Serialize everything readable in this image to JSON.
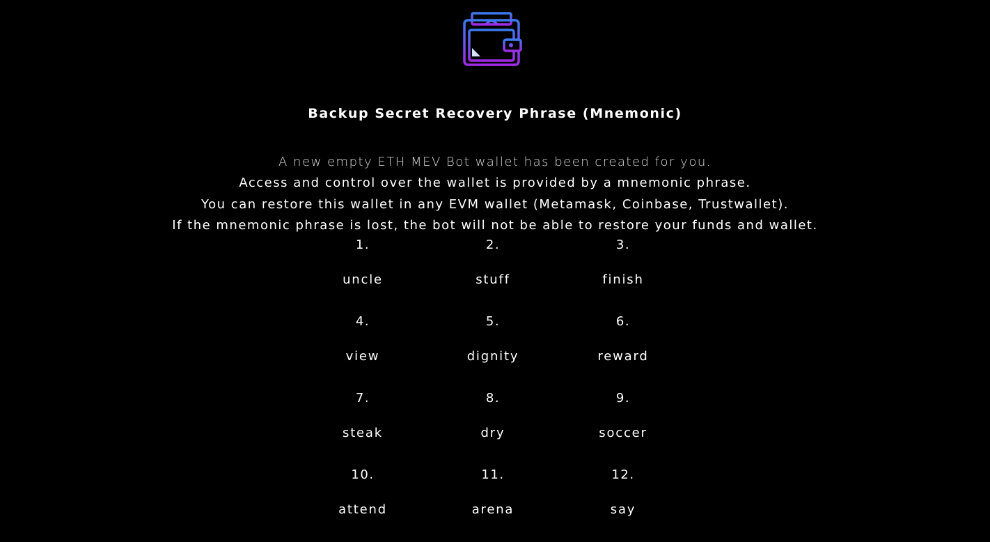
{
  "logo": {
    "icon": "wallet-icon",
    "gradient_top": "#3b7bf0",
    "gradient_bottom": "#a22be8"
  },
  "header": {
    "title": "Backup Secret Recovery Phrase (Mnemonic)"
  },
  "description": {
    "lines": [
      "A new empty ETH MEV Bot wallet has been created for you.",
      "Access and control over the wallet is provided by a mnemonic phrase.",
      "You can restore this wallet in any EVM wallet (Metamask, Coinbase, Trustwallet).",
      "If the mnemonic phrase is lost, the bot will not be able to restore your funds and wallet."
    ]
  },
  "mnemonic": {
    "words": [
      {
        "number": "1.",
        "word": "uncle"
      },
      {
        "number": "2.",
        "word": "stuff"
      },
      {
        "number": "3.",
        "word": "finish"
      },
      {
        "number": "4.",
        "word": "view"
      },
      {
        "number": "5.",
        "word": "dignity"
      },
      {
        "number": "6.",
        "word": "reward"
      },
      {
        "number": "7.",
        "word": "steak"
      },
      {
        "number": "8.",
        "word": "dry"
      },
      {
        "number": "9.",
        "word": "soccer"
      },
      {
        "number": "10.",
        "word": "attend"
      },
      {
        "number": "11.",
        "word": "arena"
      },
      {
        "number": "12.",
        "word": "say"
      }
    ]
  }
}
